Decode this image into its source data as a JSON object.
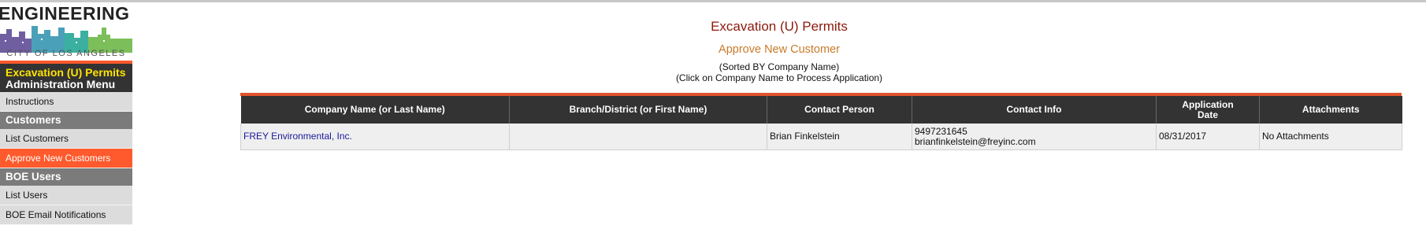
{
  "logo": {
    "title": "ENGINEERING",
    "subtitle": "CITY OF LOS ANGELES"
  },
  "menu": {
    "app_name": "Excavation (U) Permits",
    "menu_name": "Administration Menu",
    "items": [
      {
        "type": "item",
        "label": "Instructions"
      },
      {
        "type": "section",
        "label": "Customers"
      },
      {
        "type": "item",
        "label": "List Customers"
      },
      {
        "type": "item",
        "label": "Approve New Customers",
        "active": true
      },
      {
        "type": "section",
        "label": "BOE Users"
      },
      {
        "type": "item",
        "label": "List Users"
      },
      {
        "type": "item",
        "label": "BOE Email Notifications"
      }
    ]
  },
  "page": {
    "title": "Excavation (U) Permits",
    "subtitle": "Approve New Customer",
    "note1": "(Sorted BY Company Name)",
    "note2": "(Click on Company Name to Process Application)"
  },
  "table": {
    "headers": {
      "company": "Company Name (or Last Name)",
      "branch": "Branch/District (or First Name)",
      "contact": "Contact Person",
      "info": "Contact Info",
      "date_line1": "Application",
      "date_line2": "Date",
      "attachments": "Attachments"
    },
    "rows": [
      {
        "company": "FREY Environmental, Inc.",
        "branch": "",
        "contact": "Brian Finkelstein",
        "phone": "9497231645",
        "email": "brianfinkelstein@freyinc.com",
        "date": "08/31/2017",
        "attachments": "No Attachments"
      }
    ]
  },
  "colors": {
    "accent": "#ff5a2d",
    "menu_header": "#333333",
    "title": "#8b1a0d",
    "subtitle": "#c87a2a",
    "link": "#1a1a9c"
  }
}
